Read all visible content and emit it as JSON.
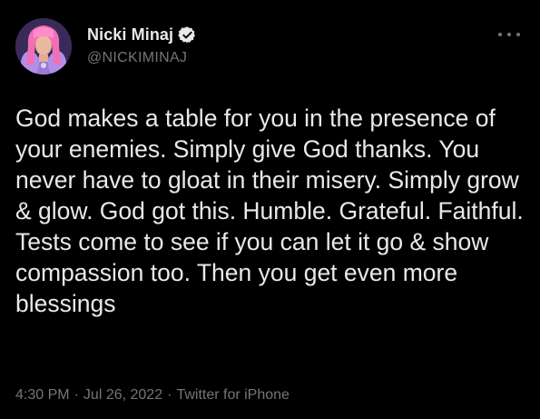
{
  "author": {
    "display_name": "Nicki Minaj",
    "handle": "@NICKIMINAJ",
    "verified": true,
    "avatar_icon": "profile-photo"
  },
  "more_icon": "ellipsis-icon",
  "tweet": {
    "text": "God makes a table for you in the presence of your enemies. Simply give God thanks. You never have to gloat in their misery. Simply grow & glow. God got this. Humble. Grateful. Faithful. Tests come to see if you can let it go & show compassion too. Then you get even more blessings"
  },
  "meta": {
    "time": "4:30 PM",
    "separator": "·",
    "date": "Jul 26, 2022",
    "source": "Twitter for iPhone"
  },
  "colors": {
    "background": "#000000",
    "primary_text": "#e7e9ea",
    "secondary_text": "#71767b",
    "verified_badge": "#1d9bf0"
  }
}
